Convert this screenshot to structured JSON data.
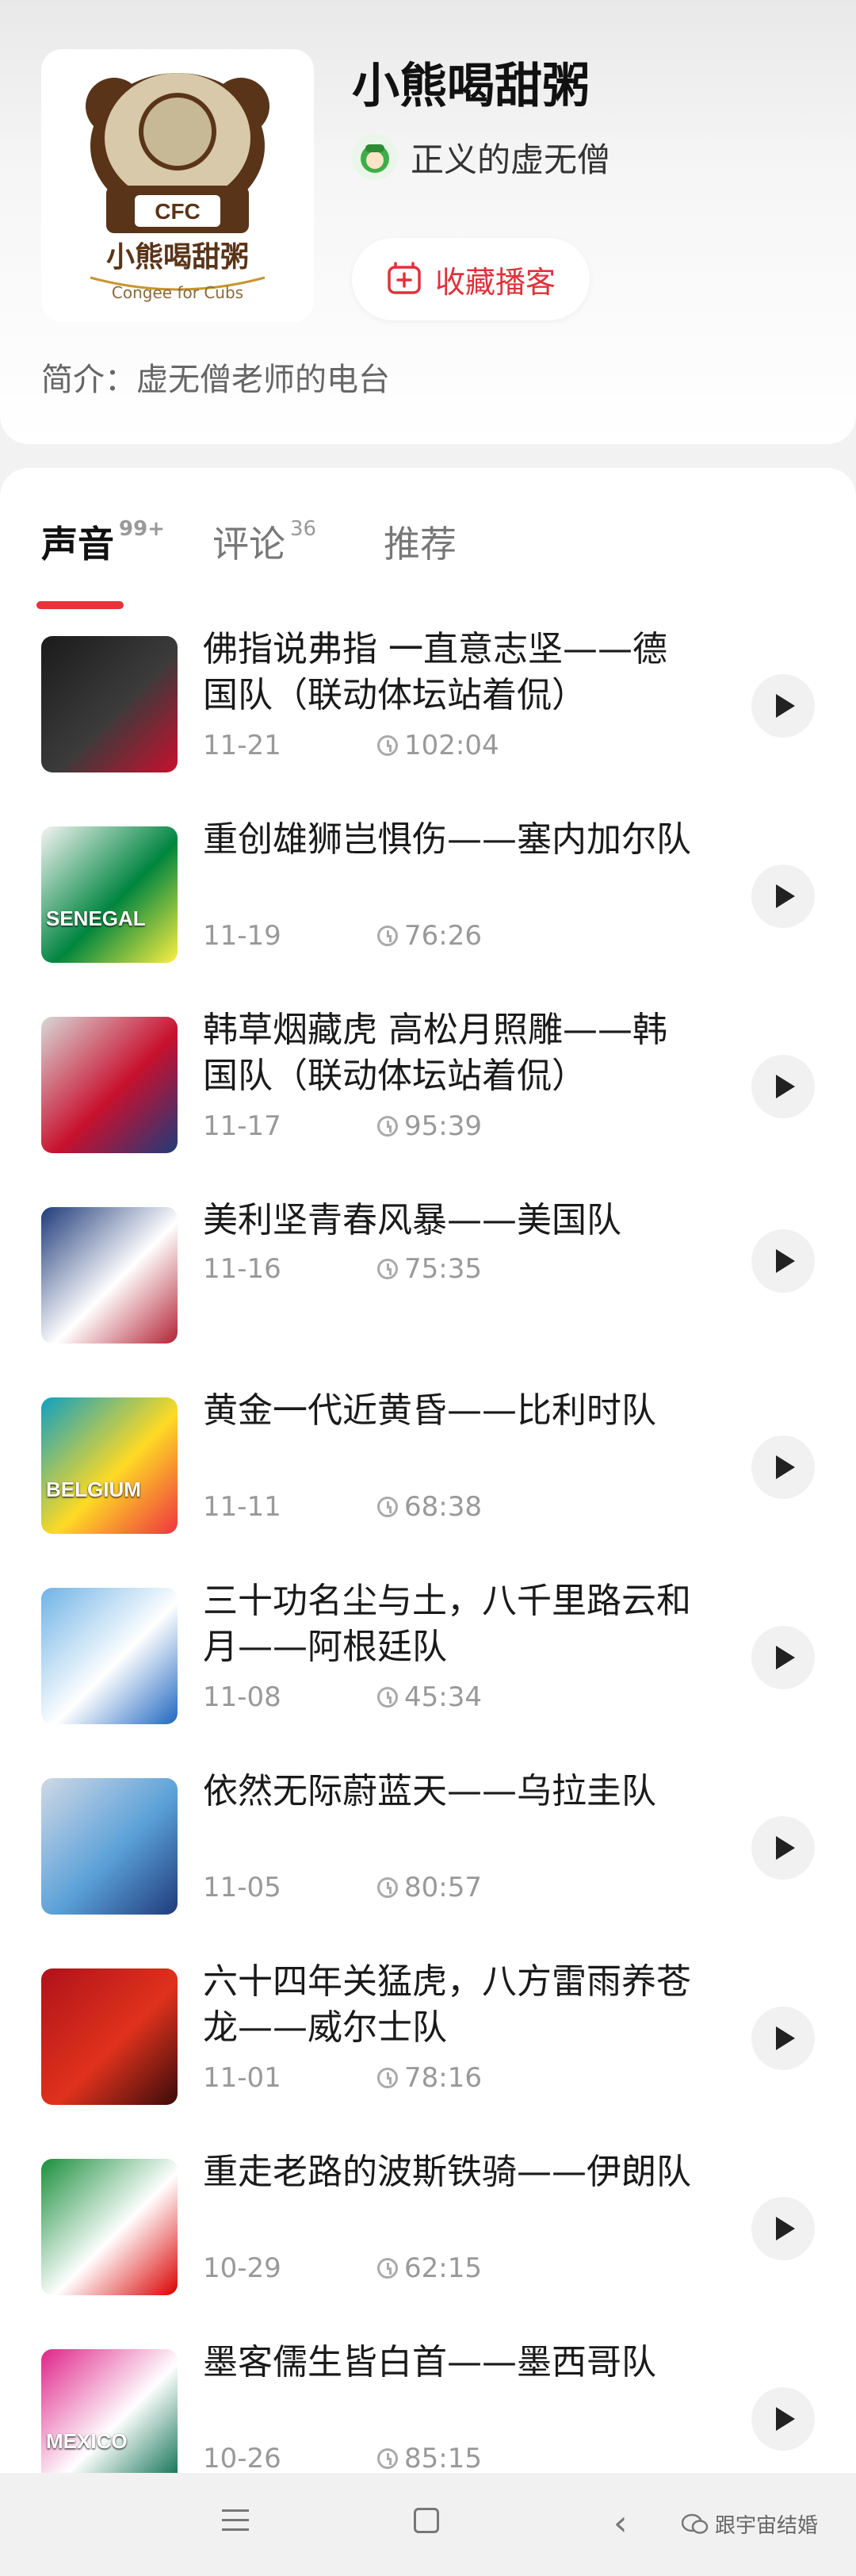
{
  "podcast": {
    "title": "小熊喝甜粥",
    "cover_badge": "CFC",
    "cover_name": "小熊喝甜粥",
    "cover_subtitle": "Congee for Cubs",
    "author_name": "正义的虚无僧",
    "favorite_label": "收藏播客",
    "intro_label": "简介：",
    "intro_text": "虚无僧老师的电台"
  },
  "tabs": [
    {
      "label": "声音",
      "badge": "99+",
      "active": true
    },
    {
      "label": "评论",
      "badge": "36",
      "active": false
    },
    {
      "label": "推荐",
      "badge": "",
      "active": false
    }
  ],
  "episodes": [
    {
      "title": "佛指说弗指 一直意志坚——德国队（联动体坛站着侃）",
      "date": "11-21",
      "duration": "102:04",
      "thumb_text": ""
    },
    {
      "title": "重创雄狮岂惧伤——塞内加尔队",
      "date": "11-19",
      "duration": "76:26",
      "thumb_text": "SENEGAL"
    },
    {
      "title": "韩草烟藏虎 高松月照雕——韩国队（联动体坛站着侃）",
      "date": "11-17",
      "duration": "95:39",
      "thumb_text": ""
    },
    {
      "title": "美利坚青春风暴——美国队",
      "date": "11-16",
      "duration": "75:35",
      "thumb_text": ""
    },
    {
      "title": "黄金一代近黄昏——比利时队",
      "date": "11-11",
      "duration": "68:38",
      "thumb_text": "BELGIUM"
    },
    {
      "title": "三十功名尘与土，八千里路云和月——阿根廷队",
      "date": "11-08",
      "duration": "45:34",
      "thumb_text": ""
    },
    {
      "title": "依然无际蔚蓝天——乌拉圭队",
      "date": "11-05",
      "duration": "80:57",
      "thumb_text": ""
    },
    {
      "title": "六十四年关猛虎，八方雷雨养苍龙——威尔士队",
      "date": "11-01",
      "duration": "78:16",
      "thumb_text": ""
    },
    {
      "title": "重走老路的波斯铁骑——伊朗队",
      "date": "10-29",
      "duration": "62:15",
      "thumb_text": ""
    },
    {
      "title": "墨客儒生皆白首——墨西哥队",
      "date": "10-26",
      "duration": "85:15",
      "thumb_text": "MEXICO"
    }
  ],
  "thumb_colors": [
    [
      "#1b1b1b",
      "#3b3b3b",
      "#c8102e"
    ],
    [
      "#f4f4f4",
      "#00853f",
      "#fdef42"
    ],
    [
      "#d8d8d8",
      "#c8102e",
      "#1f3b7a"
    ],
    [
      "#1f3b7a",
      "#ffffff",
      "#b22234"
    ],
    [
      "#0fa0c0",
      "#fdda24",
      "#ef3340"
    ],
    [
      "#6fb3e6",
      "#ffffff",
      "#1f66c0"
    ],
    [
      "#cfd9e6",
      "#5aa0d8",
      "#1f3b7a"
    ],
    [
      "#b0121b",
      "#e0321c",
      "#3a0b0b"
    ],
    [
      "#1a8f3c",
      "#ffffff",
      "#da0000"
    ],
    [
      "#e0248a",
      "#ffffff",
      "#006847"
    ]
  ],
  "nav": {
    "back_glyph": "‹",
    "watermark": "跟宇宙结婚"
  },
  "colors": {
    "accent": "#e8323c",
    "text_primary": "#1a1a1a",
    "text_secondary": "#999999"
  }
}
